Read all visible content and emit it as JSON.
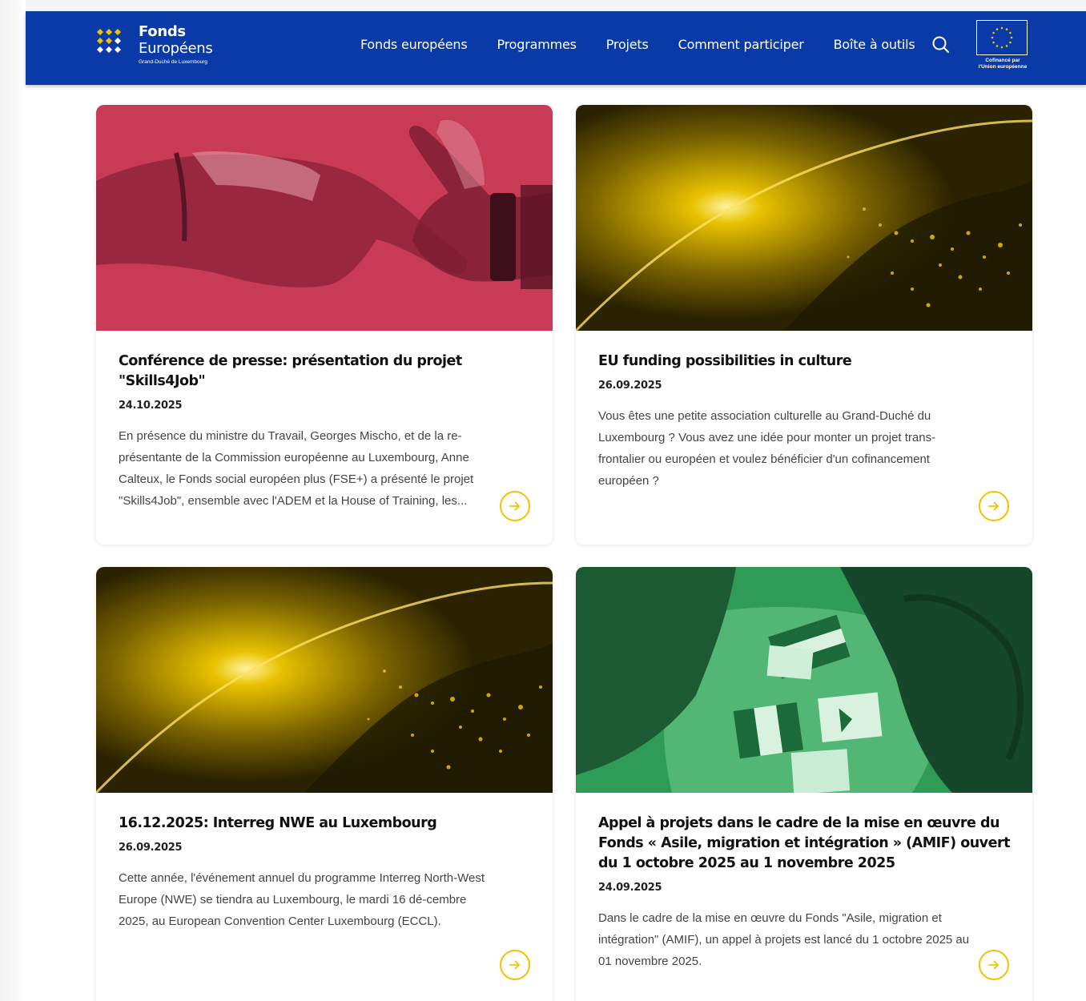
{
  "brand": {
    "name_line1": "Fonds",
    "name_line2": "Européens",
    "subtitle": "Grand-Duché de Luxembourg",
    "eu_badge_text_line1": "Cofinancé par",
    "eu_badge_text_line2": "l'Union européenne"
  },
  "nav": {
    "items": [
      {
        "label": "Fonds européens"
      },
      {
        "label": "Programmes"
      },
      {
        "label": "Projets"
      },
      {
        "label": "Comment participer"
      },
      {
        "label": "Boîte à outils"
      }
    ],
    "search_icon": "search-icon"
  },
  "colors": {
    "header_bg": "#0a3aa8",
    "accent_yellow": "#f2c200",
    "card1_tint": "#c83a55",
    "card2_tint": "#c9a400",
    "card4_tint": "#2e9b57"
  },
  "cards": [
    {
      "title": "Conférence de presse: présentation du projet \"Skills4Job\"",
      "date": "24.10.2025",
      "text": "En présence du ministre du Travail, Georges Mischo, et de la re-présentante de la Commission européenne au Luxembourg, Anne Calteux, le Fonds social européen plus (FSE+) a présenté le projet \"Skills4Job\", ensemble avec l'ADEM et la House of Training, les...",
      "image": "handshake"
    },
    {
      "title": "EU funding possibilities in culture",
      "date": "26.09.2025",
      "text": "Vous êtes une petite association culturelle au Grand-Duché du Luxembourg ? Vous avez une idée pour monter un projet trans-frontalier ou européen et voulez bénéficier d'un cofinancement européen ?",
      "image": "europe-night-map"
    },
    {
      "title": "16.12.2025: Interreg NWE au Luxembourg",
      "date": "26.09.2025",
      "text": "Cette année, l'événement annuel du programme Interreg North-West Europe (NWE) se tiendra au Luxembourg, le mardi 16 dé-cembre 2025, au European Convention Center Luxembourg (ECCL).",
      "image": "europe-night-map"
    },
    {
      "title": "Appel à projets dans le cadre de la mise en œuvre du Fonds « Asile, migration et intégration » (AMIF) ouvert du 1 octobre 2025 au 1 novembre 2025",
      "date": "24.09.2025",
      "text": "Dans le cadre de la mise en œuvre du Fonds \"Asile, migration et intégration\" (AMIF), un appel à projets est lancé du 1 octobre 2025 au 01 novembre 2025.",
      "image": "children-drawing-flags"
    }
  ]
}
